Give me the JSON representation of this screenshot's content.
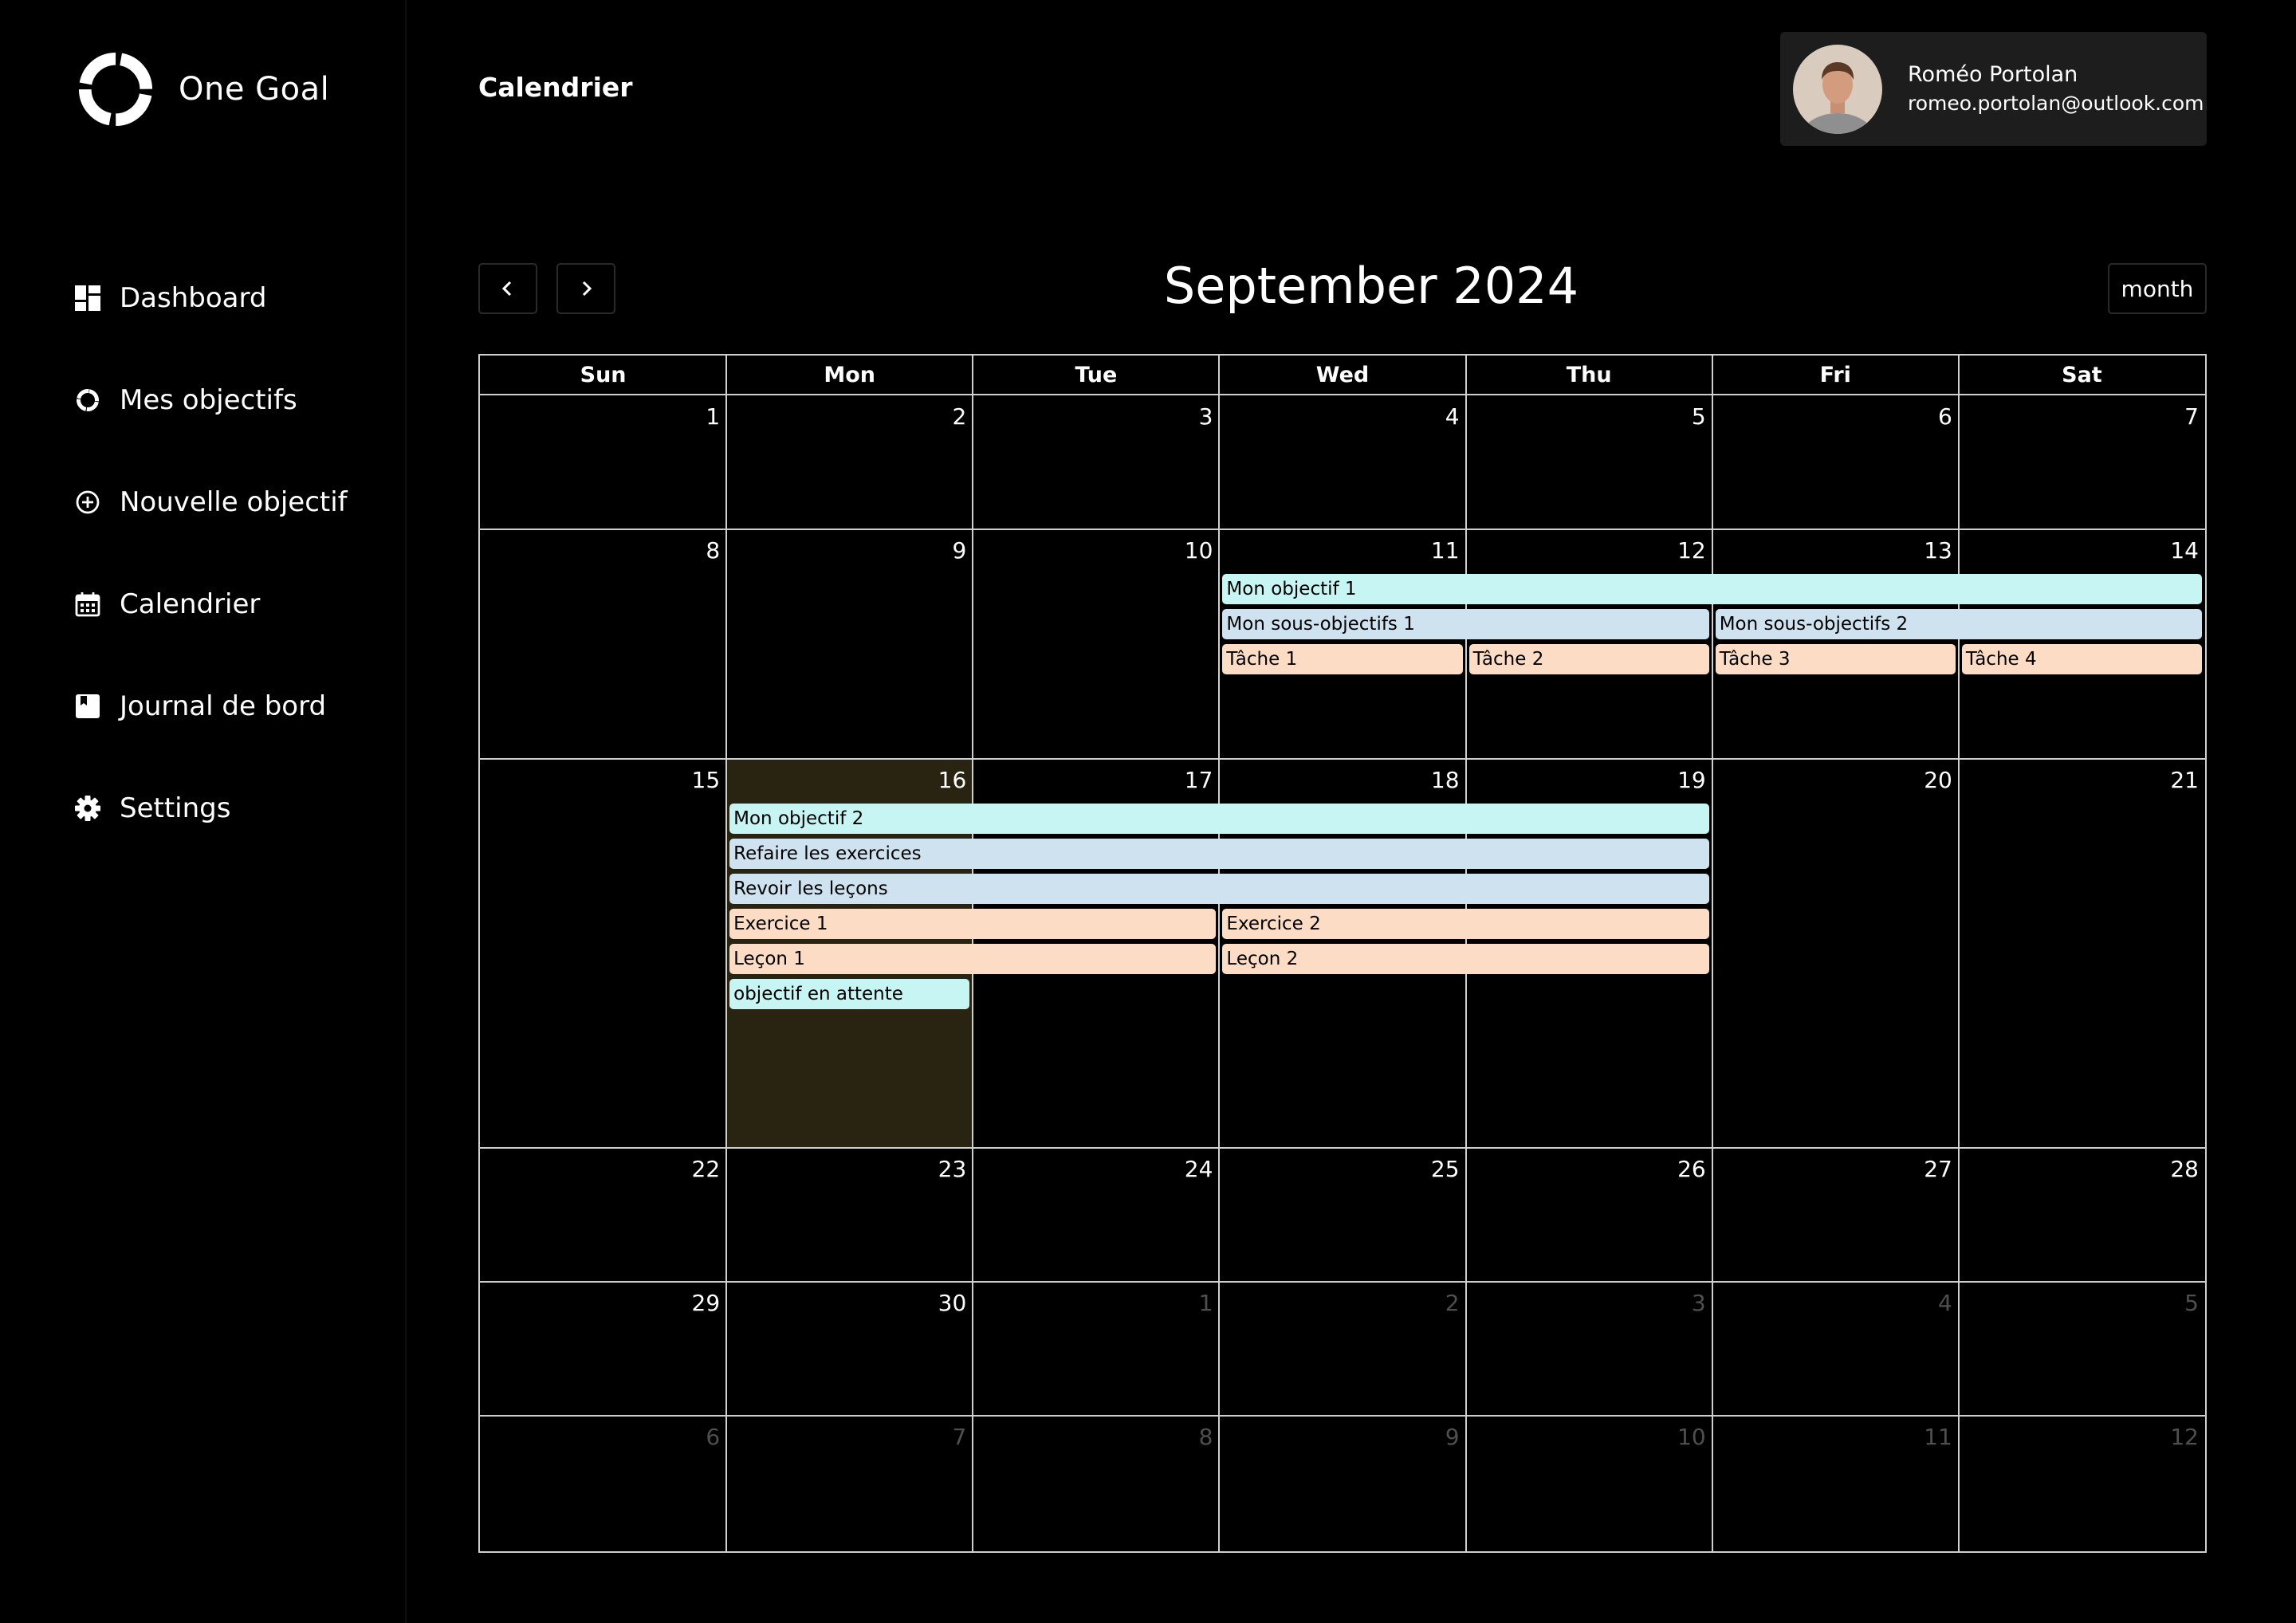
{
  "brand": {
    "name": "One Goal"
  },
  "nav": [
    {
      "label": "Dashboard",
      "icon": "dashboard-icon"
    },
    {
      "label": "Mes objectifs",
      "icon": "goal-ring-icon"
    },
    {
      "label": "Nouvelle objectif",
      "icon": "plus-circle-icon"
    },
    {
      "label": "Calendrier",
      "icon": "calendar-icon"
    },
    {
      "label": "Journal de bord",
      "icon": "journal-icon"
    },
    {
      "label": "Settings",
      "icon": "gear-icon"
    }
  ],
  "header": {
    "title": "Calendrier"
  },
  "user": {
    "name": "Roméo Portolan",
    "email": "romeo.portolan@outlook.com"
  },
  "calendar": {
    "title": "September 2024",
    "view": "month",
    "prev_icon": "chevron-left-icon",
    "next_icon": "chevron-right-icon",
    "weekdays": [
      "Sun",
      "Mon",
      "Tue",
      "Wed",
      "Thu",
      "Fri",
      "Sat"
    ],
    "weeks": [
      [
        "1",
        "2",
        "3",
        "4",
        "5",
        "6",
        "7"
      ],
      [
        "8",
        "9",
        "10",
        "11",
        "12",
        "13",
        "14"
      ],
      [
        "15",
        "16",
        "17",
        "18",
        "19",
        "20",
        "21"
      ],
      [
        "22",
        "23",
        "24",
        "25",
        "26",
        "27",
        "28"
      ],
      [
        "29",
        "30",
        "1",
        "2",
        "3",
        "4",
        "5"
      ],
      [
        "6",
        "7",
        "8",
        "9",
        "10",
        "11",
        "12"
      ]
    ],
    "muted": [
      [
        false,
        false,
        false,
        false,
        false,
        false,
        false
      ],
      [
        false,
        false,
        false,
        false,
        false,
        false,
        false
      ],
      [
        false,
        false,
        false,
        false,
        false,
        false,
        false
      ],
      [
        false,
        false,
        false,
        false,
        false,
        false,
        false
      ],
      [
        false,
        false,
        true,
        true,
        true,
        true,
        true
      ],
      [
        true,
        true,
        true,
        true,
        true,
        true,
        true
      ]
    ],
    "today": {
      "week": 2,
      "day": 1
    },
    "events": [
      {
        "title": "Mon objectif 1",
        "week": 1,
        "start": 3,
        "end": 6,
        "row": 0,
        "kind": "goal"
      },
      {
        "title": "Mon sous-objectifs 1",
        "week": 1,
        "start": 3,
        "end": 4,
        "row": 1,
        "kind": "sub"
      },
      {
        "title": "Mon sous-objectifs 2",
        "week": 1,
        "start": 5,
        "end": 6,
        "row": 1,
        "kind": "sub"
      },
      {
        "title": "Tâche 1",
        "week": 1,
        "start": 3,
        "end": 3,
        "row": 2,
        "kind": "task"
      },
      {
        "title": "Tâche 2",
        "week": 1,
        "start": 4,
        "end": 4,
        "row": 2,
        "kind": "task"
      },
      {
        "title": "Tâche 3",
        "week": 1,
        "start": 5,
        "end": 5,
        "row": 2,
        "kind": "task"
      },
      {
        "title": "Tâche 4",
        "week": 1,
        "start": 6,
        "end": 6,
        "row": 2,
        "kind": "task"
      },
      {
        "title": "Mon objectif 2",
        "week": 2,
        "start": 1,
        "end": 4,
        "row": 0,
        "kind": "goal"
      },
      {
        "title": "Refaire les exercices",
        "week": 2,
        "start": 1,
        "end": 4,
        "row": 1,
        "kind": "sub"
      },
      {
        "title": "Revoir les leçons",
        "week": 2,
        "start": 1,
        "end": 4,
        "row": 2,
        "kind": "sub"
      },
      {
        "title": "Exercice 1",
        "week": 2,
        "start": 1,
        "end": 2,
        "row": 3,
        "kind": "task"
      },
      {
        "title": "Exercice 2",
        "week": 2,
        "start": 3,
        "end": 4,
        "row": 3,
        "kind": "task"
      },
      {
        "title": "Leçon 1",
        "week": 2,
        "start": 1,
        "end": 2,
        "row": 4,
        "kind": "task"
      },
      {
        "title": "Leçon 2",
        "week": 2,
        "start": 3,
        "end": 4,
        "row": 4,
        "kind": "task"
      },
      {
        "title": "objectif en attente",
        "week": 2,
        "start": 1,
        "end": 1,
        "row": 5,
        "kind": "goal"
      }
    ]
  }
}
